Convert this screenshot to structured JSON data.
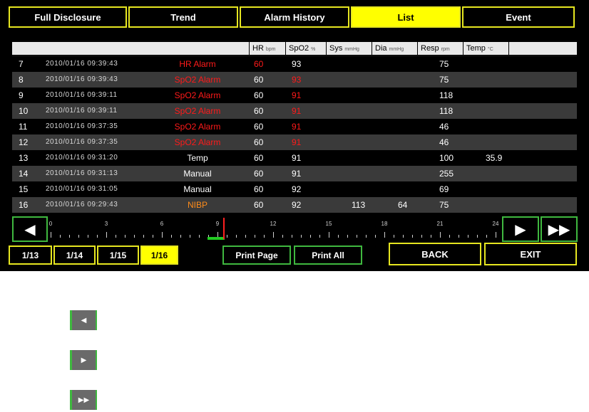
{
  "tabs": [
    {
      "label": "Full Disclosure",
      "active": false
    },
    {
      "label": "Trend",
      "active": false
    },
    {
      "label": "Alarm History",
      "active": false
    },
    {
      "label": "List",
      "active": true
    },
    {
      "label": "Event",
      "active": false
    }
  ],
  "table": {
    "headers": [
      {
        "label": "HR",
        "unit": "bpm"
      },
      {
        "label": "SpO2",
        "unit": "%"
      },
      {
        "label": "Sys",
        "unit": "mmHg"
      },
      {
        "label": "Dia",
        "unit": "mmHg"
      },
      {
        "label": "Resp",
        "unit": "rpm"
      },
      {
        "label": "Temp",
        "unit": "°C"
      }
    ],
    "rows": [
      {
        "idx": "7",
        "time": "2010/01/16 09:39:43",
        "alarm": "HR Alarm",
        "alarm_color": "red",
        "hr": "60",
        "hr_red": true,
        "spo2": "93",
        "spo2_red": false,
        "sys": "",
        "dia": "",
        "resp": "75",
        "temp": ""
      },
      {
        "idx": "8",
        "time": "2010/01/16 09:39:43",
        "alarm": "SpO2 Alarm",
        "alarm_color": "red",
        "hr": "60",
        "hr_red": false,
        "spo2": "93",
        "spo2_red": true,
        "sys": "",
        "dia": "",
        "resp": "75",
        "temp": ""
      },
      {
        "idx": "9",
        "time": "2010/01/16 09:39:11",
        "alarm": "SpO2 Alarm",
        "alarm_color": "red",
        "hr": "60",
        "hr_red": false,
        "spo2": "91",
        "spo2_red": true,
        "sys": "",
        "dia": "",
        "resp": "118",
        "temp": ""
      },
      {
        "idx": "10",
        "time": "2010/01/16 09:39:11",
        "alarm": "SpO2 Alarm",
        "alarm_color": "red",
        "hr": "60",
        "hr_red": false,
        "spo2": "91",
        "spo2_red": true,
        "sys": "",
        "dia": "",
        "resp": "118",
        "temp": ""
      },
      {
        "idx": "11",
        "time": "2010/01/16 09:37:35",
        "alarm": "SpO2 Alarm",
        "alarm_color": "red",
        "hr": "60",
        "hr_red": false,
        "spo2": "91",
        "spo2_red": true,
        "sys": "",
        "dia": "",
        "resp": "46",
        "temp": ""
      },
      {
        "idx": "12",
        "time": "2010/01/16 09:37:35",
        "alarm": "SpO2 Alarm",
        "alarm_color": "red",
        "hr": "60",
        "hr_red": false,
        "spo2": "91",
        "spo2_red": true,
        "sys": "",
        "dia": "",
        "resp": "46",
        "temp": ""
      },
      {
        "idx": "13",
        "time": "2010/01/16 09:31:20",
        "alarm": "Temp",
        "alarm_color": "white",
        "hr": "60",
        "hr_red": false,
        "spo2": "91",
        "spo2_red": false,
        "sys": "",
        "dia": "",
        "resp": "100",
        "temp": "35.9"
      },
      {
        "idx": "14",
        "time": "2010/01/16 09:31:13",
        "alarm": "Manual",
        "alarm_color": "white",
        "hr": "60",
        "hr_red": false,
        "spo2": "91",
        "spo2_red": false,
        "sys": "",
        "dia": "",
        "resp": "255",
        "temp": ""
      },
      {
        "idx": "15",
        "time": "2010/01/16 09:31:05",
        "alarm": "Manual",
        "alarm_color": "white",
        "hr": "60",
        "hr_red": false,
        "spo2": "92",
        "spo2_red": false,
        "sys": "",
        "dia": "",
        "resp": "69",
        "temp": ""
      },
      {
        "idx": "16",
        "time": "2010/01/16 09:29:43",
        "alarm": "NIBP",
        "alarm_color": "orange",
        "hr": "60",
        "hr_red": false,
        "spo2": "92",
        "spo2_red": false,
        "sys": "113",
        "dia": "64",
        "resp": "75",
        "temp": ""
      }
    ]
  },
  "timeline": {
    "labels": [
      "0",
      "3",
      "6",
      "9",
      "12",
      "15",
      "18",
      "21",
      "24"
    ],
    "cursor_hour": 9.3
  },
  "nav": {
    "prev_label": "◀",
    "next_label": "▶",
    "fast_next_label": "▶▶"
  },
  "dates": [
    {
      "label": "1/13",
      "active": false
    },
    {
      "label": "1/14",
      "active": false
    },
    {
      "label": "1/15",
      "active": false
    },
    {
      "label": "1/16",
      "active": true
    }
  ],
  "print": {
    "page_label": "Print Page",
    "all_label": "Print All"
  },
  "controls": {
    "back_label": "BACK",
    "exit_label": "EXIT"
  },
  "legend": [
    {
      "icon": "prev-arrow-icon",
      "label": "◀"
    },
    {
      "icon": "next-arrow-icon",
      "label": "▶"
    },
    {
      "icon": "fast-forward-icon",
      "label": "▶▶"
    }
  ],
  "colors": {
    "tab_border": "#e6e620",
    "active_fill": "#ffff00",
    "nav_border": "#3fb83f",
    "alarm_red": "#ff1a1a",
    "nibp_orange": "#ff8c1a"
  }
}
